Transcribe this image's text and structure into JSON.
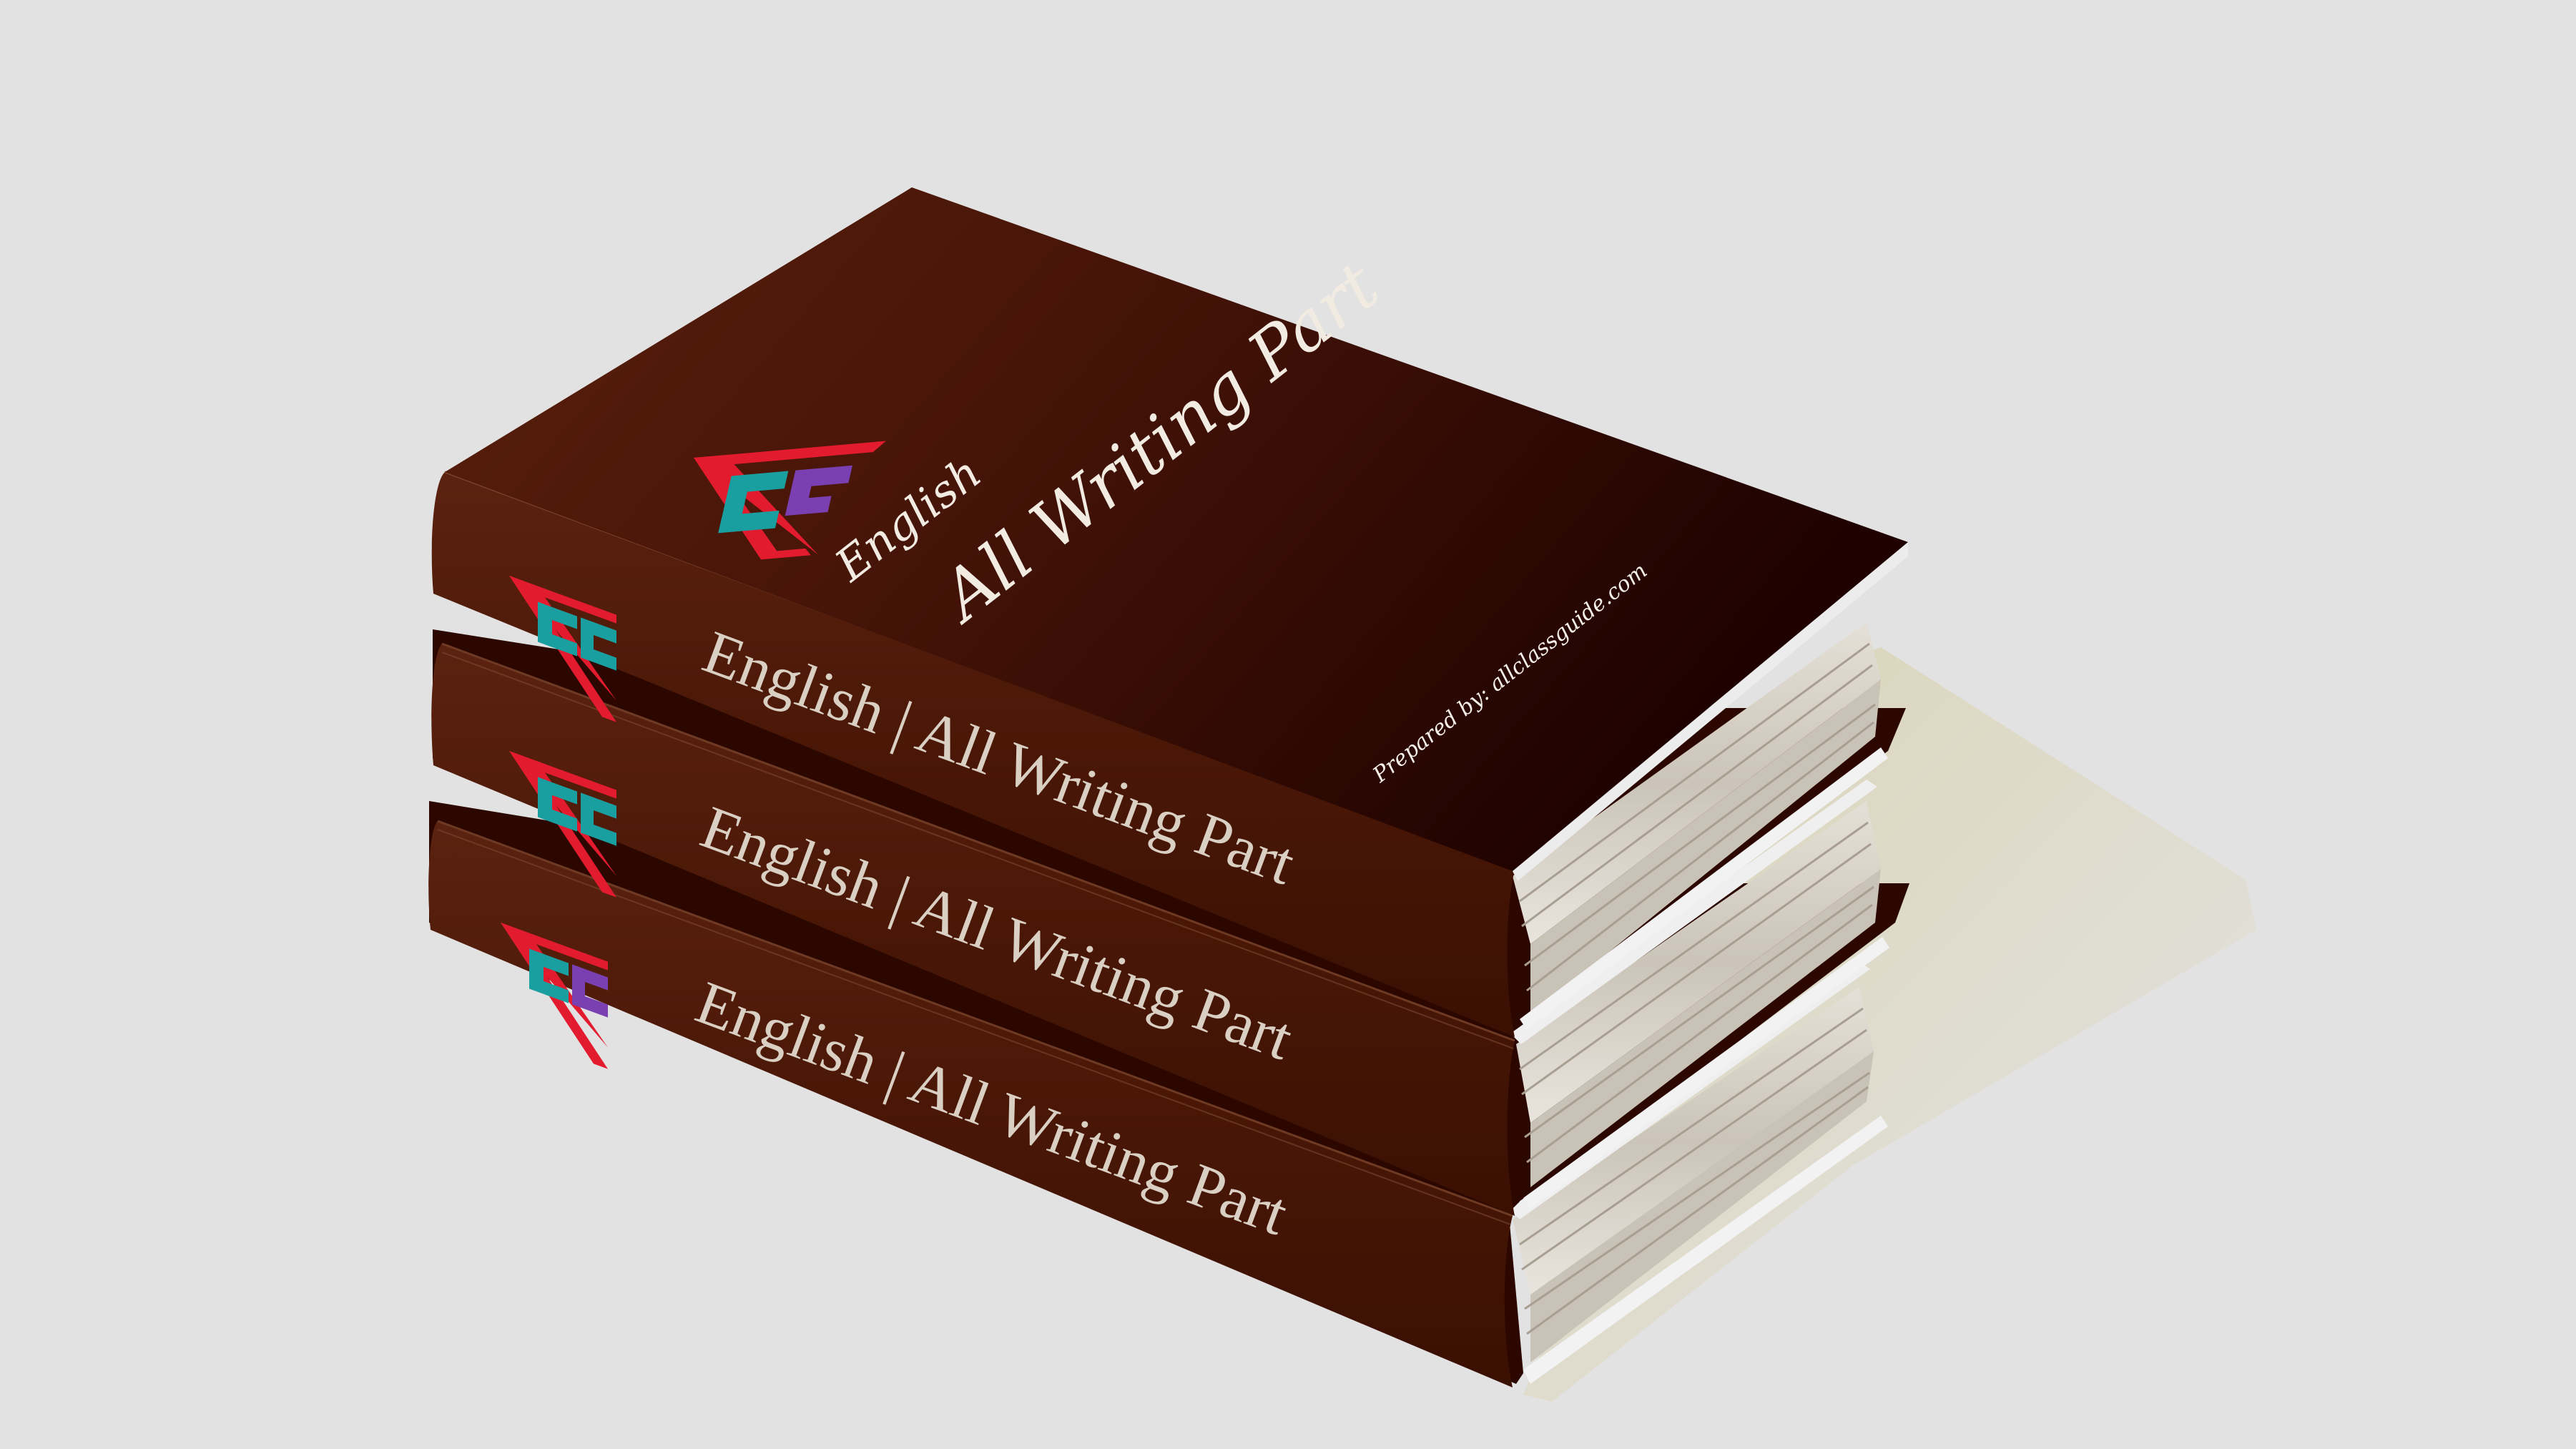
{
  "image": {
    "background_color": "#e2e2e2",
    "book_color": "#4a1a08",
    "book_color_dark": "#1e0300",
    "page_edge_color": "#d6d0c6",
    "shadow_color": "#d4cdb0"
  },
  "books": [
    {
      "position": "bottom",
      "spine_title": "English | All Writing Part"
    },
    {
      "position": "middle",
      "spine_title": "English | All Writing Part"
    },
    {
      "position": "top",
      "spine_title": "English | All Writing Part",
      "cover": {
        "subject": "English",
        "title": "All Writing Part",
        "credit": "Prepared by: allclassguide.com"
      }
    }
  ],
  "logo": {
    "name": "triangle-logo",
    "colors": {
      "outline": "#e31b2f",
      "teal": "#1a9fa0",
      "purple": "#7a3fb0"
    }
  }
}
